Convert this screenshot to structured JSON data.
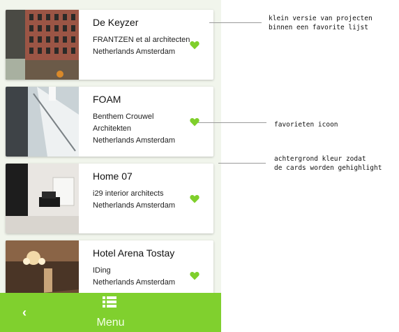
{
  "projects": [
    {
      "name": "De Keyzer",
      "office": "FRANTZEN et al architecten",
      "location": "Netherlands Amsterdam"
    },
    {
      "name": "FOAM",
      "office": "Benthem Crouwel",
      "office_line2": "Architekten",
      "location": "Netherlands Amsterdam"
    },
    {
      "name": "Home 07",
      "office": "i29 interior architects",
      "location": "Netherlands Amsterdam"
    },
    {
      "name": "Hotel Arena Tostay",
      "office": "IDing",
      "location": "Netherlands Amsterdam"
    }
  ],
  "bottom_bar": {
    "back_glyph": "‹",
    "menu_label": "Menu"
  },
  "annotations": {
    "cards": "klein versie van projecten\nbinnen een favorite lijst",
    "icon": "favorieten icoon",
    "background": "achtergrond kleur zodat\nde cards worden gehighlight"
  },
  "colors": {
    "accent": "#80d02e",
    "heart": "#7fcf2b",
    "background": "#f1f5ec"
  },
  "icons": [
    "heart-icon",
    "list-menu-icon",
    "chevron-left-icon"
  ]
}
